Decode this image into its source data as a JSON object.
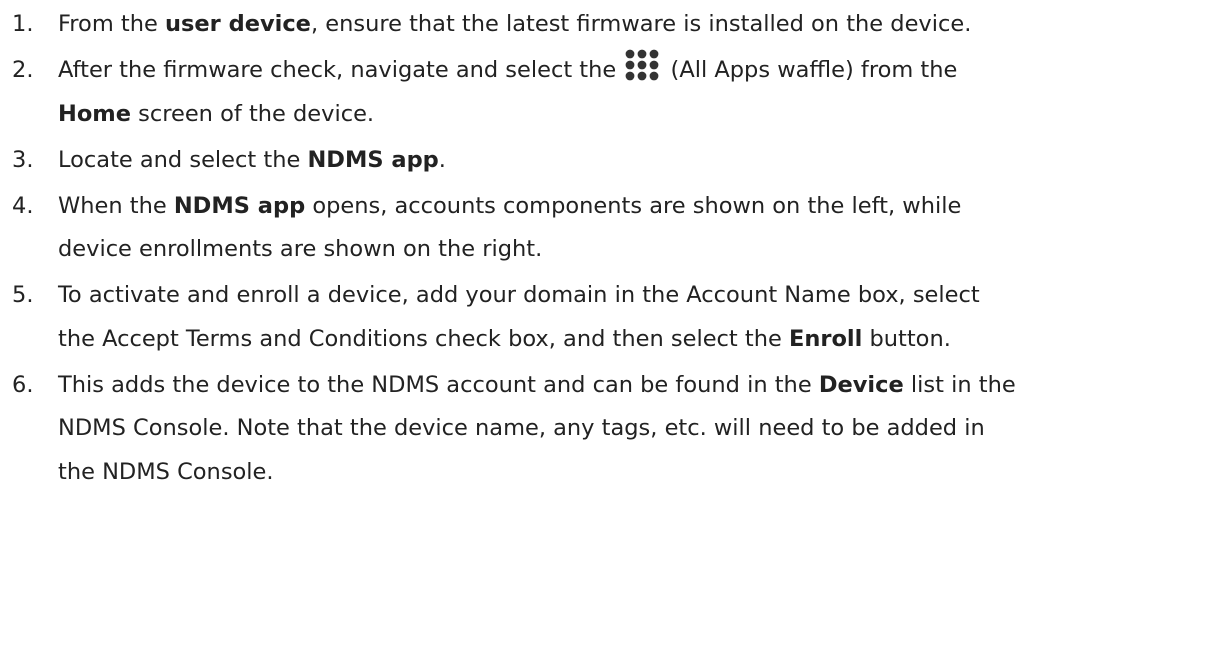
{
  "steps": [
    {
      "number": "1.",
      "lines": [
        [
          "From the ",
          {
            "b": "user device"
          },
          ", ensure that the latest firmware is installed on the device."
        ]
      ]
    },
    {
      "number": "2.",
      "lines": [
        [
          "After the firmware check, navigate and select the ",
          {
            "icon": "all-apps-waffle-icon"
          },
          " (All Apps waffle) from the"
        ],
        [
          {
            "b": "Home"
          },
          " screen of the device."
        ]
      ]
    },
    {
      "number": "3.",
      "lines": [
        [
          "Locate and select the ",
          {
            "b": "NDMS app"
          },
          "."
        ]
      ]
    },
    {
      "number": "4.",
      "lines": [
        [
          "When the ",
          {
            "b": "NDMS app"
          },
          " opens, accounts components are shown on the left, while"
        ],
        [
          "device enrollments are shown on the right."
        ]
      ]
    },
    {
      "number": "5.",
      "lines": [
        [
          "To activate and enroll a device, add your domain in the Account Name box, select"
        ],
        [
          "the Accept Terms and Conditions check box, and then select the ",
          {
            "b": "Enroll"
          },
          " button."
        ]
      ]
    },
    {
      "number": "6.",
      "lines": [
        [
          "This adds the device to the NDMS account and can be found in the ",
          {
            "b": "Device"
          },
          " list in the"
        ],
        [
          "NDMS Console. Note that the device name, any tags, etc. will need to be added in"
        ],
        [
          "the NDMS Console."
        ]
      ]
    }
  ],
  "colors": {
    "text": "#222222",
    "icon": "#333333"
  }
}
